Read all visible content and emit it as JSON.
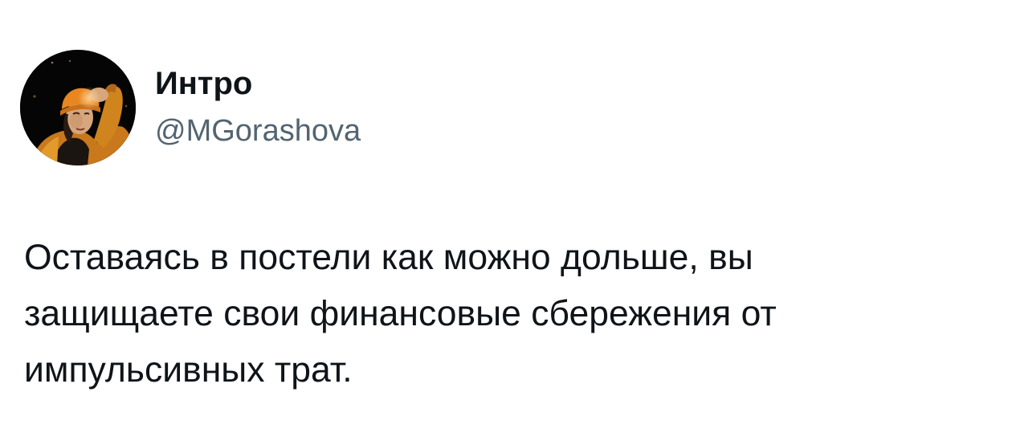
{
  "author": {
    "display_name": "Интро",
    "handle": "@MGorashova",
    "avatar_icon": "profile-photo-avatar"
  },
  "tweet": {
    "text_lines": [
      "Оставаясь в постели как можно дольше, вы",
      "защищаете свои финансовые сбережения от",
      "импульсивных трат."
    ]
  },
  "colors": {
    "background": "#ffffff",
    "text_primary": "#0f1419",
    "text_secondary": "#536471"
  }
}
